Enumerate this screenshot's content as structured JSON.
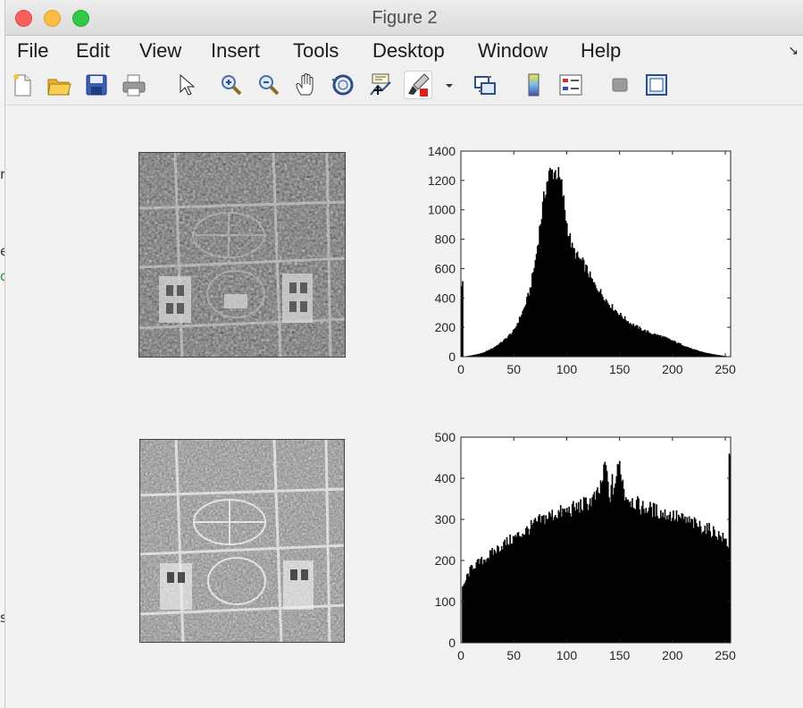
{
  "window": {
    "title": "Figure 2"
  },
  "menu": [
    "File",
    "Edit",
    "View",
    "Insert",
    "Tools",
    "Desktop",
    "Window",
    "Help"
  ],
  "toolbar": [
    {
      "name": "new-figure-icon"
    },
    {
      "name": "open-file-icon"
    },
    {
      "name": "save-icon"
    },
    {
      "name": "print-icon"
    },
    {
      "name": "pointer-icon"
    },
    {
      "name": "zoom-in-icon"
    },
    {
      "name": "zoom-out-icon"
    },
    {
      "name": "pan-icon"
    },
    {
      "name": "rotate-3d-icon"
    },
    {
      "name": "data-cursor-icon"
    },
    {
      "name": "brush-icon"
    },
    {
      "name": "brush-dropdown-icon"
    },
    {
      "name": "link-plot-icon"
    },
    {
      "name": "colorbar-icon"
    },
    {
      "name": "legend-icon"
    },
    {
      "name": "hide-plot-tools-icon"
    },
    {
      "name": "show-plot-tools-icon"
    }
  ],
  "chart_data": [
    {
      "type": "bar",
      "xlim": [
        0,
        255
      ],
      "ylim": [
        0,
        1400
      ],
      "xticks": [
        0,
        50,
        100,
        150,
        200,
        250
      ],
      "yticks": [
        0,
        200,
        400,
        600,
        800,
        1000,
        1200,
        1400
      ],
      "keypoints": [
        [
          0,
          500
        ],
        [
          1,
          500
        ],
        [
          2,
          0
        ],
        [
          10,
          10
        ],
        [
          20,
          25
        ],
        [
          30,
          60
        ],
        [
          40,
          110
        ],
        [
          50,
          180
        ],
        [
          60,
          340
        ],
        [
          65,
          460
        ],
        [
          70,
          650
        ],
        [
          75,
          920
        ],
        [
          80,
          1160
        ],
        [
          83,
          1240
        ],
        [
          87,
          1265
        ],
        [
          91,
          1250
        ],
        [
          95,
          1160
        ],
        [
          100,
          900
        ],
        [
          105,
          740
        ],
        [
          110,
          680
        ],
        [
          115,
          640
        ],
        [
          120,
          580
        ],
        [
          125,
          500
        ],
        [
          130,
          460
        ],
        [
          135,
          410
        ],
        [
          140,
          360
        ],
        [
          150,
          290
        ],
        [
          160,
          230
        ],
        [
          170,
          190
        ],
        [
          180,
          160
        ],
        [
          190,
          140
        ],
        [
          200,
          110
        ],
        [
          210,
          80
        ],
        [
          220,
          50
        ],
        [
          230,
          30
        ],
        [
          240,
          15
        ],
        [
          250,
          5
        ],
        [
          255,
          0
        ]
      ],
      "xlabel": "",
      "ylabel": "",
      "title": ""
    },
    {
      "type": "bar",
      "xlim": [
        0,
        255
      ],
      "ylim": [
        0,
        500
      ],
      "xticks": [
        0,
        50,
        100,
        150,
        200,
        250
      ],
      "yticks": [
        0,
        100,
        200,
        300,
        400,
        500
      ],
      "keypoints": [
        [
          0,
          0
        ],
        [
          1,
          130
        ],
        [
          5,
          160
        ],
        [
          10,
          185
        ],
        [
          20,
          200
        ],
        [
          30,
          220
        ],
        [
          40,
          240
        ],
        [
          50,
          255
        ],
        [
          60,
          270
        ],
        [
          70,
          290
        ],
        [
          80,
          305
        ],
        [
          90,
          315
        ],
        [
          100,
          320
        ],
        [
          110,
          330
        ],
        [
          120,
          340
        ],
        [
          130,
          360
        ],
        [
          137,
          430
        ],
        [
          140,
          355
        ],
        [
          145,
          380
        ],
        [
          150,
          440
        ],
        [
          155,
          360
        ],
        [
          160,
          350
        ],
        [
          170,
          330
        ],
        [
          180,
          325
        ],
        [
          190,
          315
        ],
        [
          200,
          310
        ],
        [
          210,
          300
        ],
        [
          220,
          290
        ],
        [
          230,
          280
        ],
        [
          240,
          270
        ],
        [
          250,
          250
        ],
        [
          253,
          240
        ],
        [
          254,
          460
        ],
        [
          255,
          460
        ]
      ],
      "spikes": [
        [
          136,
          440
        ],
        [
          150,
          442
        ],
        [
          143,
          410
        ],
        [
          132,
          395
        ],
        [
          254,
          460
        ]
      ],
      "xlabel": "",
      "ylabel": "",
      "title": ""
    }
  ]
}
